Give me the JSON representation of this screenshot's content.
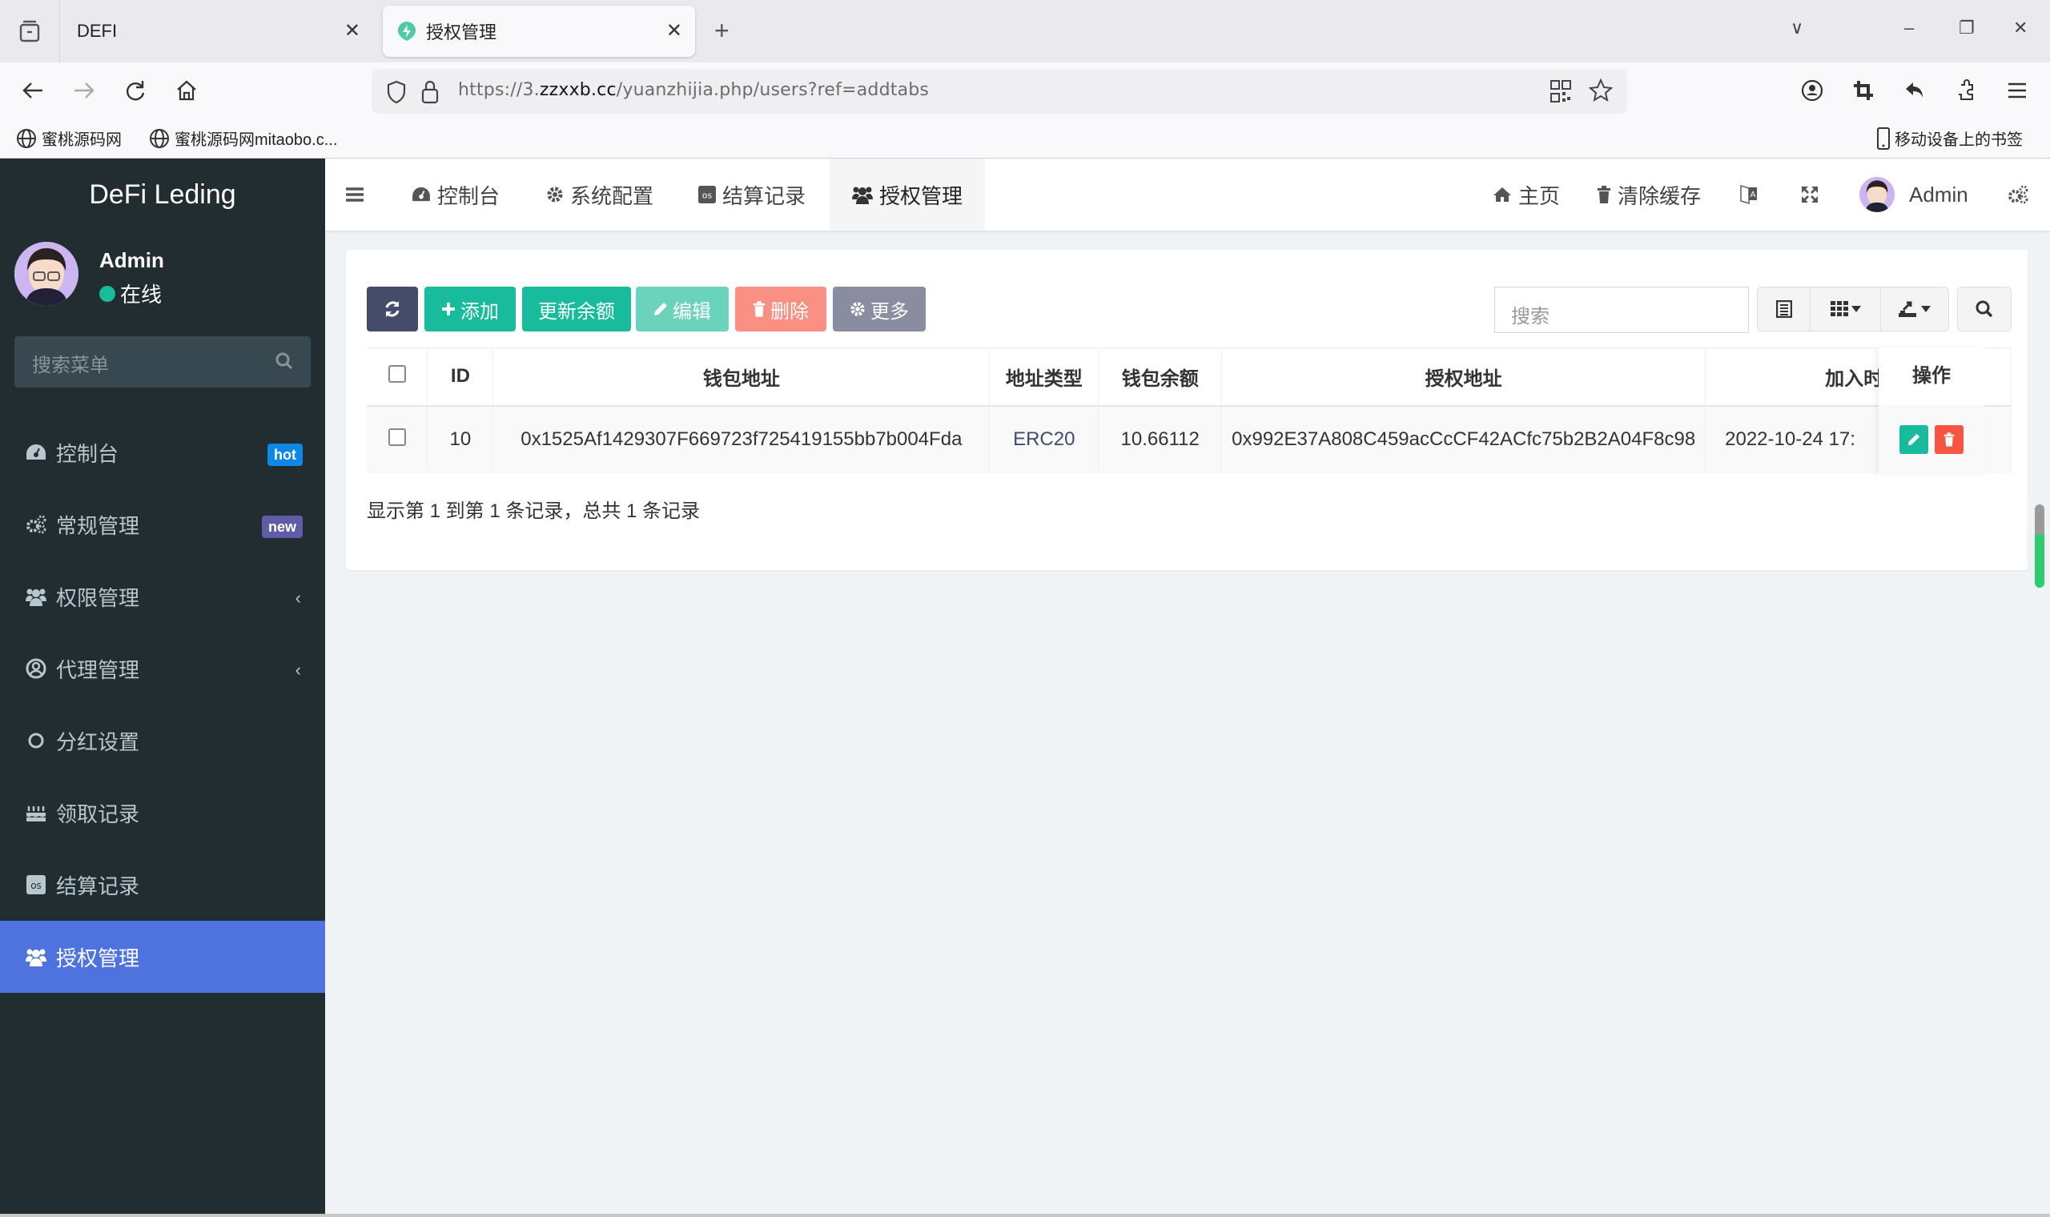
{
  "browser": {
    "tabs": [
      {
        "title": "DEFI",
        "active": false
      },
      {
        "title": "授权管理",
        "active": true
      }
    ],
    "url": {
      "prefix": "https://3.",
      "domain": "zzxxb.cc",
      "path": "/yuanzhijia.php/users?ref=addtabs"
    },
    "bookmarks": [
      {
        "label": "蜜桃源码网"
      },
      {
        "label": "蜜桃源码网mitaobo.c..."
      }
    ],
    "mobile_bookmarks": "移动设备上的书签"
  },
  "sidebar": {
    "logo": "DeFi Leding",
    "user": {
      "name": "Admin",
      "status": "在线"
    },
    "search_placeholder": "搜索菜单",
    "items": [
      {
        "label": "控制台",
        "icon": "dashboard-icon",
        "badge": "hot",
        "badge_color": "#0f87e6"
      },
      {
        "label": "常规管理",
        "icon": "cogs-icon",
        "badge": "new",
        "badge_color": "#605ca8"
      },
      {
        "label": "权限管理",
        "icon": "users-icon",
        "chevron": true
      },
      {
        "label": "代理管理",
        "icon": "user-circle-icon",
        "chevron": true
      },
      {
        "label": "分红设置",
        "icon": "circle-icon"
      },
      {
        "label": "领取记录",
        "icon": "birthday-cake-icon"
      },
      {
        "label": "结算记录",
        "icon": "lastfm-icon"
      },
      {
        "label": "授权管理",
        "icon": "users-icon",
        "active": true
      }
    ],
    "active_color": "#4e73df"
  },
  "header": {
    "nav_tabs": [
      {
        "label": "控制台",
        "icon": "dashboard-icon"
      },
      {
        "label": "系统配置",
        "icon": "cog-icon"
      },
      {
        "label": "结算记录",
        "icon": "lastfm-icon"
      },
      {
        "label": "授权管理",
        "icon": "users-icon",
        "active": true
      }
    ],
    "right": {
      "home": "主页",
      "clear_cache": "清除缓存",
      "user": "Admin"
    }
  },
  "toolbar": {
    "refresh_label": "",
    "add_label": "添加",
    "update_balance_label": "更新余额",
    "edit_label": "编辑",
    "delete_label": "删除",
    "more_label": "更多",
    "search_placeholder": "搜索"
  },
  "table": {
    "columns": [
      "ID",
      "钱包地址",
      "地址类型",
      "钱包余额",
      "授权地址",
      "加入时间",
      "操作"
    ],
    "rows": [
      {
        "id": "10",
        "wallet": "0x1525Af1429307F669723f725419155bb7b004Fda",
        "type": "ERC20",
        "balance": "10.66112",
        "auth_address": "0x992E37A808C459acCcCF42ACfc75b2B2A04F8c98",
        "joined": "2022-10-24 17:"
      }
    ],
    "summary": "显示第 1 到第 1 条记录，总共 1 条记录"
  },
  "colors": {
    "sidebar_bg": "#222d32",
    "primary": "#18bc9c",
    "dark_btn": "#444c69",
    "danger": "#f75444",
    "danger_light": "#fa9083",
    "info_light": "#6bd3bc",
    "gray_btn": "#8a8c9f"
  }
}
